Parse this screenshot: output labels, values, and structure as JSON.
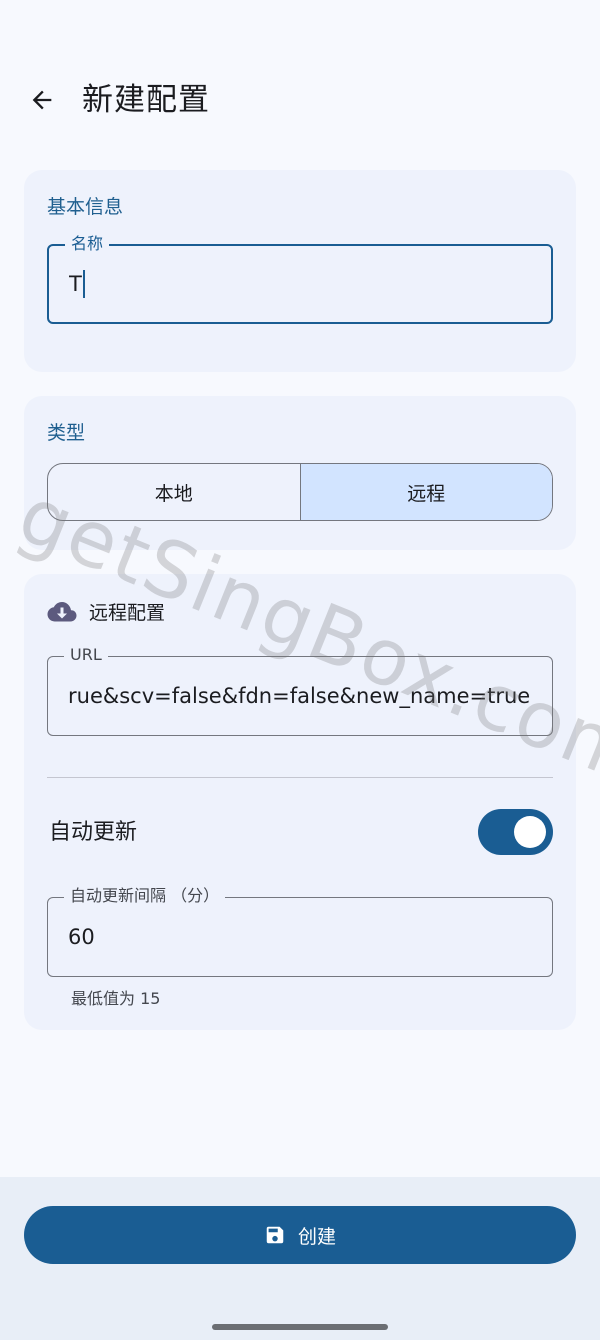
{
  "header": {
    "title": "新建配置"
  },
  "basic_info": {
    "section_title": "基本信息",
    "name_field": {
      "label": "名称",
      "value": "T"
    }
  },
  "type_section": {
    "section_title": "类型",
    "options": [
      "本地",
      "远程"
    ],
    "selected": "远程"
  },
  "remote_config": {
    "section_title": "远程配置",
    "url_field": {
      "label": "URL",
      "value": "rue&scv=false&fdn=false&new_name=true"
    },
    "auto_update": {
      "label": "自动更新",
      "enabled": true
    },
    "interval_field": {
      "label": "自动更新间隔 （分）",
      "value": "60",
      "helper": "最低值为 15"
    }
  },
  "footer": {
    "create_label": "创建"
  },
  "watermark": "getSingBox.com",
  "colors": {
    "primary": "#1a5d93",
    "card": "#eef2fc",
    "background": "#f7f9fe",
    "selected_segment": "#d2e4ff"
  }
}
